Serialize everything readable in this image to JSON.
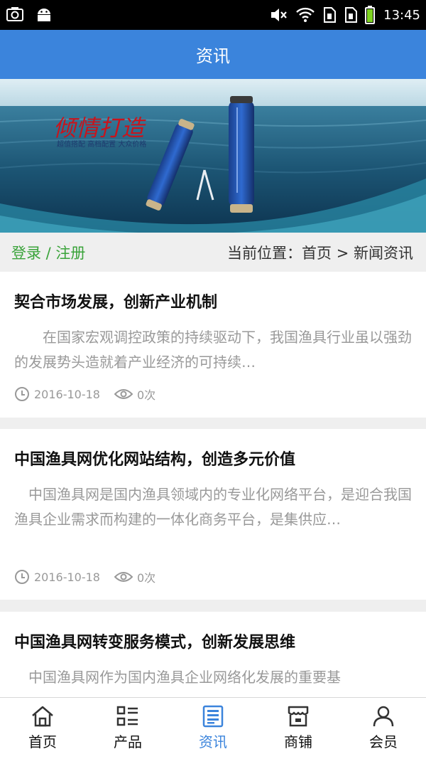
{
  "status_bar": {
    "time": "13:45"
  },
  "header": {
    "title": "资讯"
  },
  "banner": {
    "slogan": "倾情打造",
    "tagline": "超值搭配 高档配置 大众价格"
  },
  "crumb": {
    "login": "登录 / 注册",
    "location": "当前位置：首页 > 新闻资讯"
  },
  "articles": [
    {
      "title": "契合市场发展，创新产业机制",
      "excerpt": "　　在国家宏观调控政策的持续驱动下，我国渔具行业虽以强劲的发展势头造就着产业经济的可持续…",
      "date": "2016-10-18",
      "views": "0次"
    },
    {
      "title": "中国渔具网优化网站结构，创造多元价值",
      "excerpt": "　中国渔具网是国内渔具领域内的专业化网络平台，是迎合我国渔具企业需求而构建的一体化商务平台，是集供应…",
      "date": "2016-10-18",
      "views": "0次"
    },
    {
      "title": "中国渔具网转变服务模式，创新发展思维",
      "excerpt": "　中国渔具网作为国内渔具企业网络化发展的重要基",
      "date": "",
      "views": ""
    }
  ],
  "nav": [
    {
      "label": "首页",
      "icon": "home-icon"
    },
    {
      "label": "产品",
      "icon": "product-list-icon"
    },
    {
      "label": "资讯",
      "icon": "news-icon",
      "active": true
    },
    {
      "label": "商铺",
      "icon": "shop-icon"
    },
    {
      "label": "会员",
      "icon": "user-icon"
    }
  ],
  "colors": {
    "header": "#3b84dc",
    "login": "#3aa33a",
    "nav_active": "#3b84dc"
  }
}
